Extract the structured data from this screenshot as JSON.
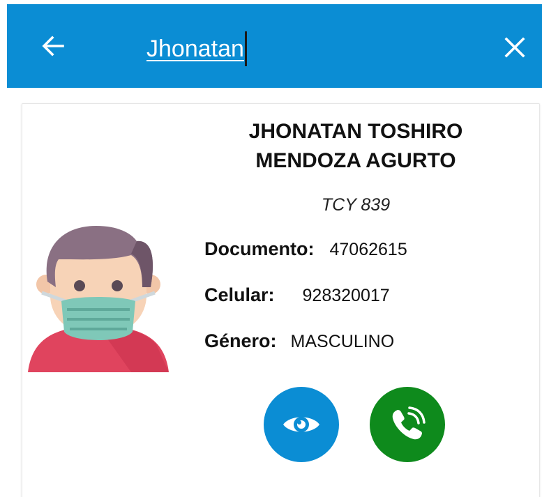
{
  "app_bar": {
    "background": "#0b8dd4",
    "back_icon": "arrow-left-icon",
    "search_value": "Jhonatan",
    "close_icon": "close-icon"
  },
  "card": {
    "name_line1": "JHONATAN TOSHIRO",
    "name_line2": "MENDOZA AGURTO",
    "plate": "TCY 839",
    "fields": {
      "documento_label": "Documento:",
      "documento_value": "47062615",
      "celular_label": "Celular:",
      "celular_value": "928320017",
      "genero_label": "Género:",
      "genero_value": "MASCULINO"
    },
    "avatar_icon": "masked-person-avatar",
    "actions": {
      "view_icon": "eye-icon",
      "view_color": "#0b8dd4",
      "call_icon": "phone-call-icon",
      "call_color": "#0e8a1c"
    }
  }
}
